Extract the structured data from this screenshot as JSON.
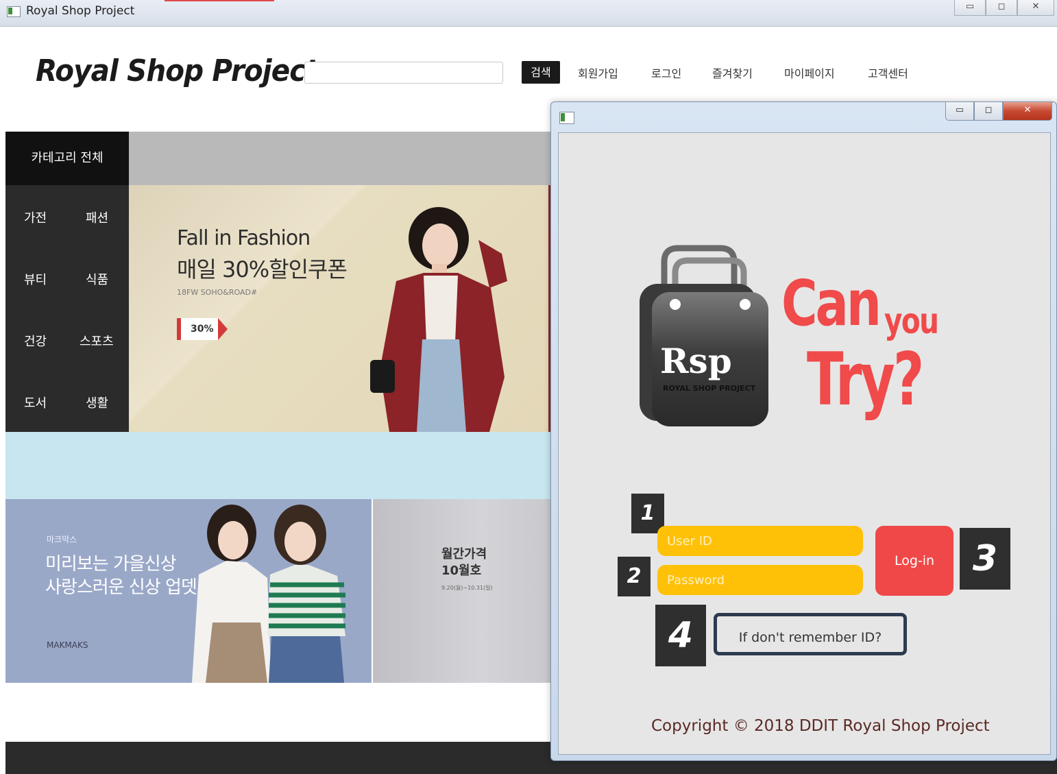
{
  "window": {
    "title": "Royal Shop Project",
    "min": "▭",
    "max": "◻",
    "close": "✕"
  },
  "header": {
    "logo": "Royal Shop Project",
    "search_button": "검색",
    "nav": [
      "회원가입",
      "로그인",
      "즐겨찾기",
      "마이페이지",
      "고객센터"
    ]
  },
  "categories": {
    "title": "카테고리 전체",
    "items": [
      "가전",
      "패션",
      "뷰티",
      "식품",
      "건강",
      "스포츠",
      "도서",
      "생활"
    ]
  },
  "banner1": {
    "title": "Fall in Fashion",
    "subtitle": "매일 30%할인쿠폰",
    "small": "18FW SOHO&ROAD#",
    "badge": "30%"
  },
  "banner2": {
    "brand": "마크막스",
    "line1": "미리보는 가을신상",
    "line2": "사랑스러운 신상 업뎃!",
    "footer": "MAKMAKS"
  },
  "banner3": {
    "line1": "월간가격",
    "line2": "10월호",
    "small": "9.20(월)~10.31(일)"
  },
  "login": {
    "logo_text": "Rsp",
    "logo_sub": "ROYAL SHOP PROJECT",
    "slogan_can": "Can",
    "slogan_you": "you",
    "slogan_try": "Try?",
    "userid_placeholder": "User ID",
    "password_placeholder": "Password",
    "login_button": "Log-in",
    "forgot_button": "If don't remember ID?",
    "markers": [
      "1",
      "2",
      "3",
      "4"
    ],
    "copyright": "Copyright © 2018 DDIT Royal Shop Project"
  },
  "colors": {
    "accent_red": "#f04a4a",
    "field_yellow": "#ffc107",
    "dark": "#2b2b2b"
  }
}
